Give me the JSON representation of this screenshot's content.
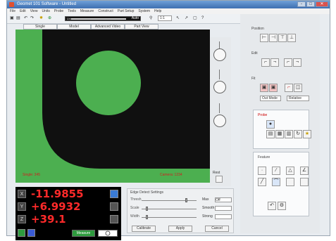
{
  "window": {
    "title": "Geomet 101 Software - Untitled",
    "min": "-",
    "max": "□",
    "close": "✕"
  },
  "menu": [
    "File",
    "Edit",
    "View",
    "Units",
    "Probe",
    "Tools",
    "Measure",
    "Construct",
    "Part Setup",
    "System",
    "Help"
  ],
  "toolbar": {
    "slider_label": "Live",
    "slider_value": "Auto",
    "zoom": "1:1",
    "items": [
      "↖",
      "↗",
      "▢",
      "?"
    ]
  },
  "tabs": [
    "Single",
    "Model",
    "Advanced Video",
    "Part View"
  ],
  "viewport": {
    "top_left_label": "Single: 345",
    "bottom_right_label": "Camera: 1234",
    "colors": {
      "bg": "#4caf50",
      "dark": "#101010",
      "circle": "#4caf50"
    }
  },
  "side": {
    "bottom_label": "Rest"
  },
  "dro": {
    "x": "-11.9855",
    "y": "+6.9932",
    "z": "+39.1",
    "x_label": "X",
    "y_label": "Y",
    "z_label": "Z",
    "progress_label": "Measure"
  },
  "settings": {
    "title": "Edge Detect Settings",
    "rows": [
      {
        "label": "Thresh",
        "value": "Max",
        "sel": "Off"
      },
      {
        "label": "Scale",
        "value": "Smooth",
        "sel": ""
      },
      {
        "label": "Width",
        "value": "Strong",
        "sel": ""
      }
    ],
    "buttons": [
      "Calibrate",
      "Apply",
      "Cancel"
    ]
  },
  "rpanel": {
    "sections": [
      "Position",
      "Edit",
      "Fit",
      "Probe",
      "Feature"
    ],
    "dd1": "Out Mode",
    "dd2": "Relative"
  }
}
